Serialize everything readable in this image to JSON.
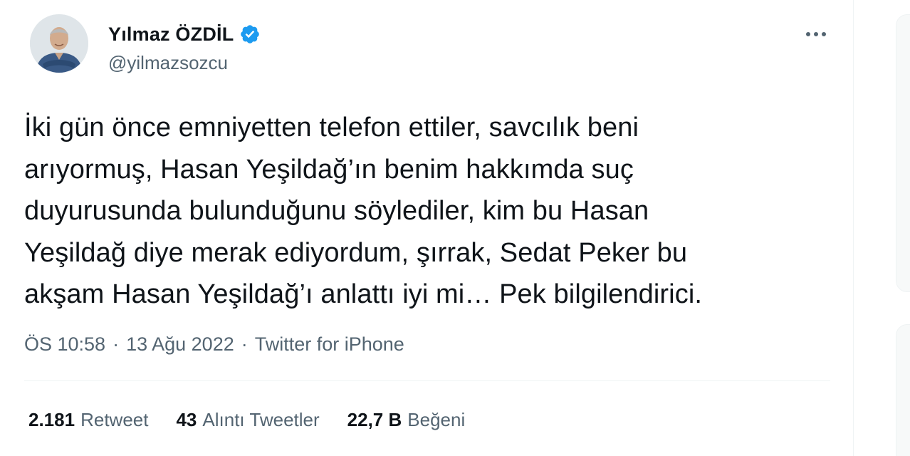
{
  "author": {
    "display_name": "Yılmaz ÖZDİL",
    "handle": "@yilmazsozcu",
    "verified_icon": "verified-badge-icon",
    "avatar": "profile-photo"
  },
  "tweet": {
    "lines": [
      "İki gün önce emniyetten telefon ettiler, savcılık beni",
      "arıyormuş, Hasan Yeşildağ’ın benim hakkımda suç",
      "duyurusunda bulunduğunu söylediler, kim bu Hasan",
      "Yeşildağ diye merak ediyordum, şırrak, Sedat Peker bu",
      "akşam Hasan Yeşildağ’ı anlattı iyi mi… Pek bilgilendirici."
    ]
  },
  "meta": {
    "time": "ÖS 10:58",
    "separator": "·",
    "date": "13 Ağu 2022",
    "source": "Twitter for iPhone"
  },
  "stats": {
    "retweets": {
      "count": "2.181",
      "label": "Retweet"
    },
    "quotes": {
      "count": "43",
      "label": "Alıntı Tweetler"
    },
    "likes": {
      "count": "22,7 B",
      "label": "Beğeni"
    }
  },
  "colors": {
    "text": "#0f1419",
    "secondary": "#536471",
    "verified": "#1d9bf0",
    "divider": "#eff3f4"
  }
}
